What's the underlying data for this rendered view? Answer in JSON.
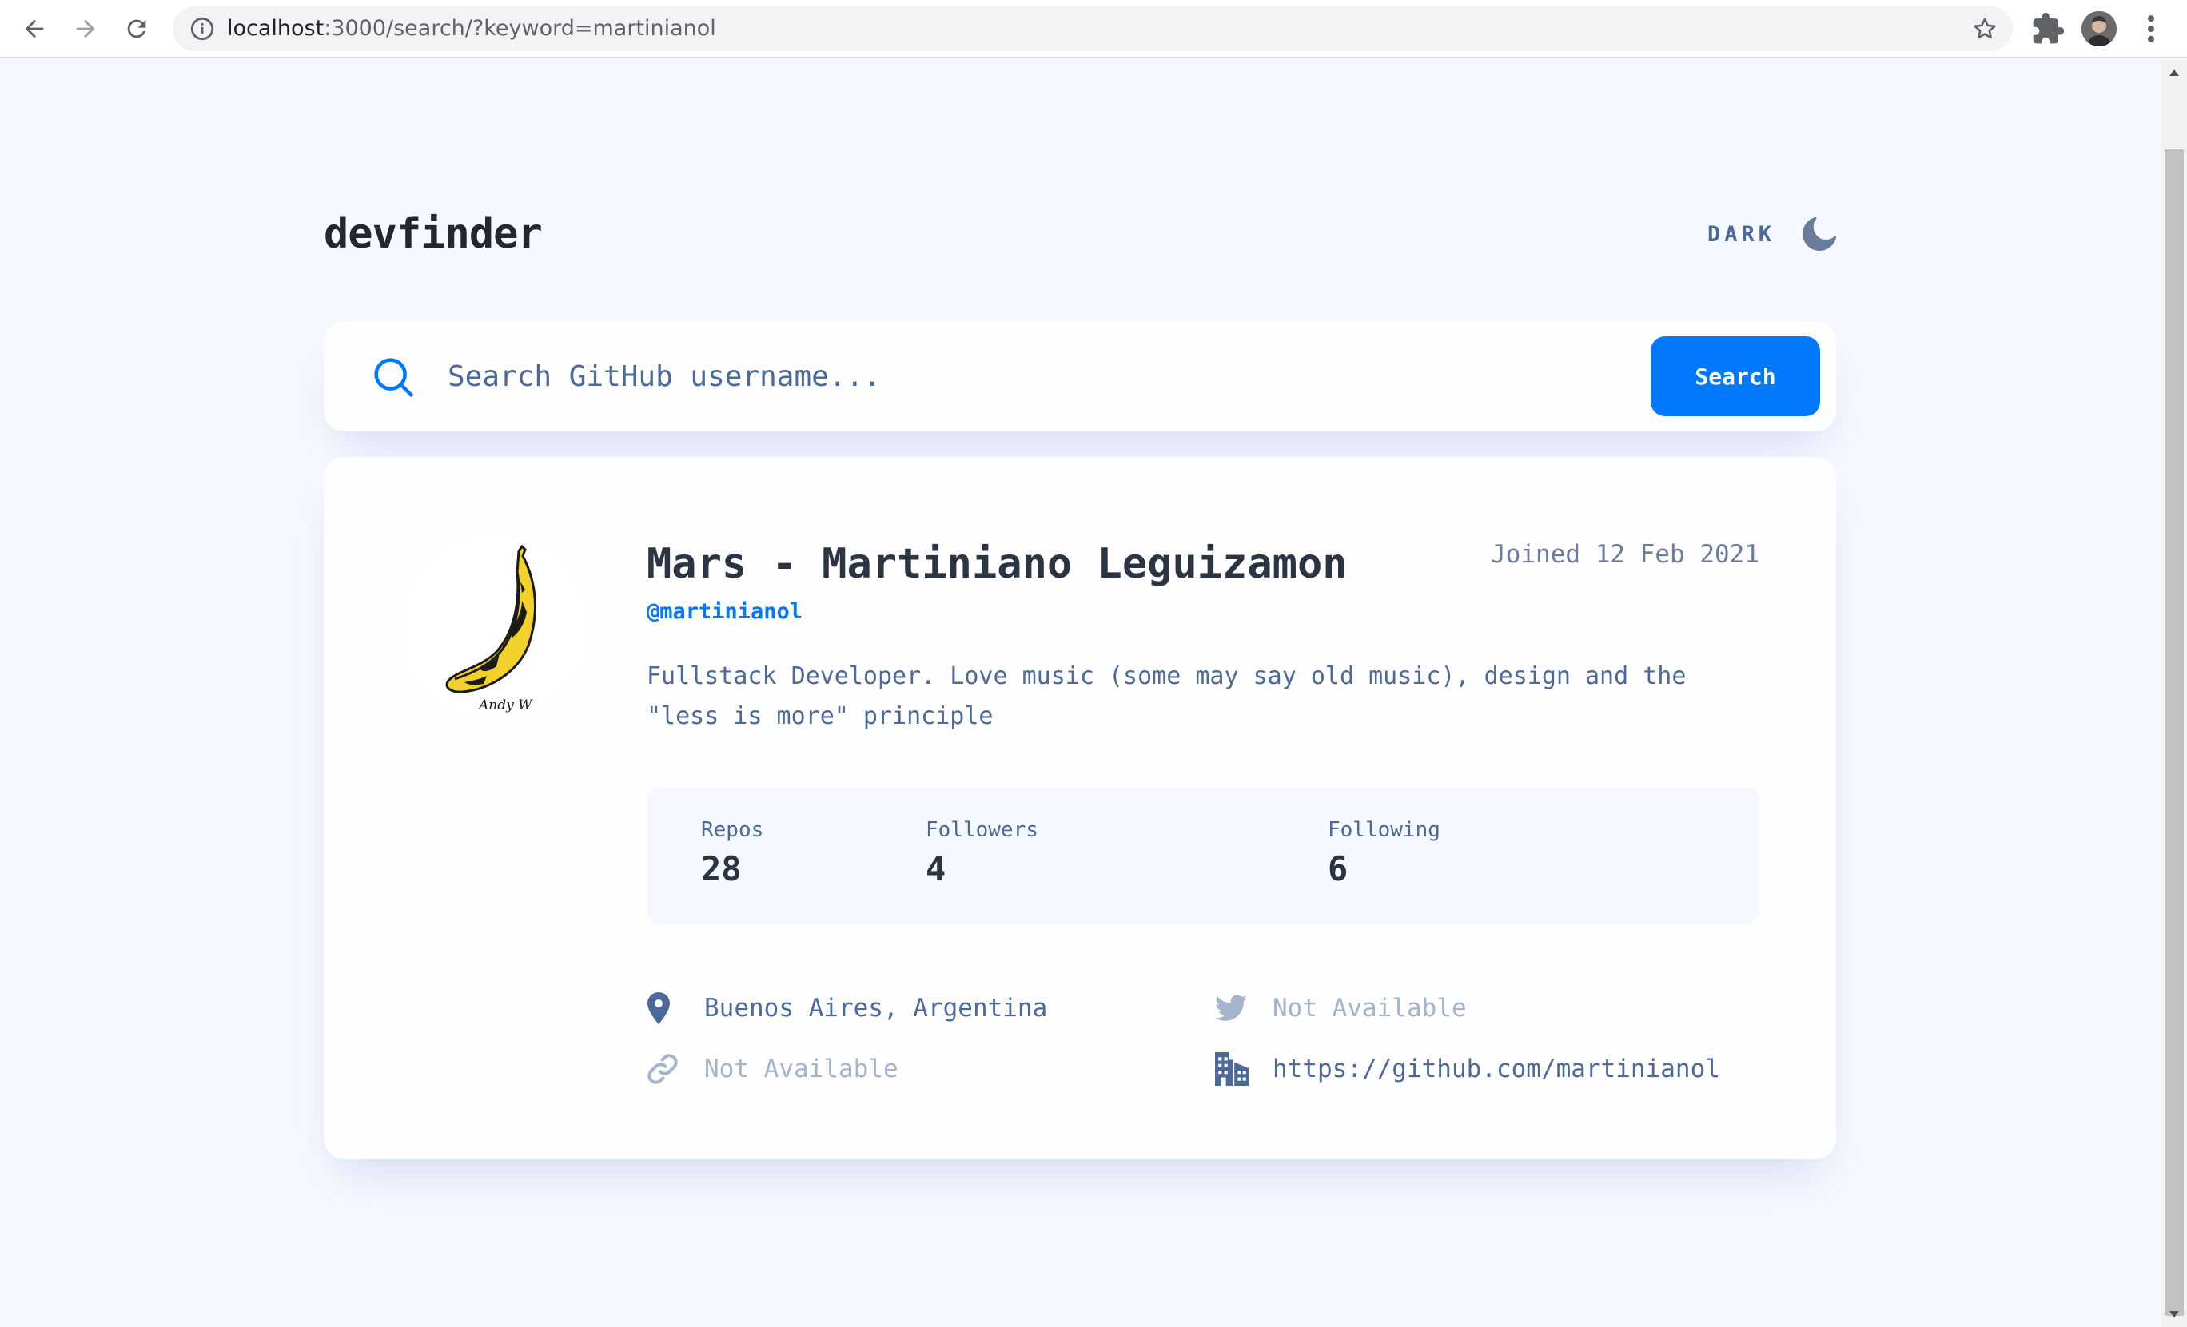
{
  "browser": {
    "url_host": "localhost",
    "url_rest": ":3000/search/?keyword=martinianol"
  },
  "app": {
    "logo": "devfinder",
    "theme_toggle_label": "DARK"
  },
  "search": {
    "placeholder": "Search GitHub username...",
    "button_label": "Search"
  },
  "profile": {
    "name": "Mars - Martiniano Leguizamon",
    "login": "@martinianol",
    "joined": "Joined 12 Feb 2021",
    "bio": "Fullstack Developer. Love music (some may say old music), design and the \"less is more\" principle",
    "avatar_signature": "Andy W",
    "stats": {
      "repos_label": "Repos",
      "repos_value": "28",
      "followers_label": "Followers",
      "followers_value": "4",
      "following_label": "Following",
      "following_value": "6"
    },
    "links": {
      "location": "Buenos Aires, Argentina",
      "twitter": "Not Available",
      "blog": "Not Available",
      "company": "https://github.com/martinianol"
    }
  },
  "colors": {
    "background": "#f6f8ff",
    "card": "#fefefe",
    "accent": "#0079ff",
    "text_primary": "#2b3442",
    "text_secondary": "#4b6a9b",
    "text_disabled": "#a3b4cc"
  },
  "icons": {
    "location": "map-pin-icon",
    "twitter": "twitter-icon",
    "blog": "link-icon",
    "company": "building-icon",
    "theme": "moon-icon",
    "search": "search-icon"
  }
}
